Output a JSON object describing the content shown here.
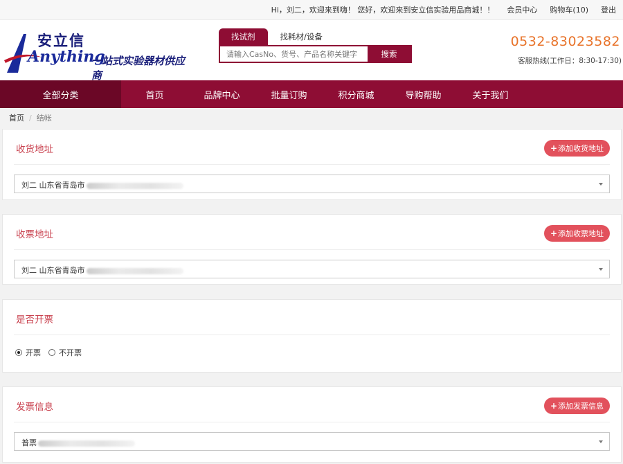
{
  "topbar": {
    "greeting": "Hi，刘二，欢迎来到嗨！ 您好，欢迎来到安立信实验用品商城！！",
    "member_center": "会员中心",
    "cart": "购物车(10)",
    "logout": "登出"
  },
  "header": {
    "logo": {
      "brand_cn": "安立信",
      "brand_en": "Anything",
      "slogan": "一站式实验器材供应商"
    },
    "search": {
      "tabs": [
        "找试剂",
        "找耗材/设备"
      ],
      "placeholder": "请输入CasNo、货号、产品名称关键字",
      "button": "搜索"
    },
    "hotline": {
      "number": "0532-83023582",
      "label": "客服热线(工作日：8:30-17:30)"
    }
  },
  "nav": {
    "all_categories": "全部分类",
    "items": [
      "首页",
      "品牌中心",
      "批量订购",
      "积分商城",
      "导购帮助",
      "关于我们"
    ]
  },
  "breadcrumb": {
    "home": "首页",
    "separator": "/",
    "current": "结帐"
  },
  "shipping": {
    "title": "收货地址",
    "add_button": "添加收货地址",
    "selected": "刘二 山东省青岛市"
  },
  "billing": {
    "title": "收票地址",
    "add_button": "添加收票地址",
    "selected": "刘二 山东省青岛市"
  },
  "invoice_choice": {
    "title": "是否开票",
    "options": [
      "开票",
      "不开票"
    ],
    "selected": "开票"
  },
  "invoice_info": {
    "title": "发票信息",
    "add_button": "添加发票信息",
    "selected": "普票"
  },
  "colors": {
    "brand": "#8e0d34",
    "nav_dark": "#6b0726",
    "accent": "#e2515c",
    "title": "#c9424f",
    "hotline": "#e8732a"
  }
}
